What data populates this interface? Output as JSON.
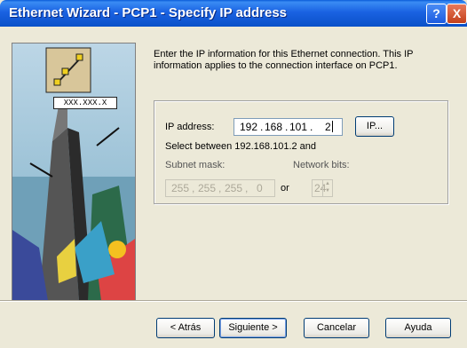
{
  "window": {
    "title": "Ethernet Wizard - PCP1 - Specify IP address",
    "help_glyph": "?",
    "close_glyph": "X"
  },
  "intro": "Enter the IP information for this Ethernet connection. This IP information applies to the connection interface on PCP1.",
  "art": {
    "placeholder_text": "XXX.XXX.X"
  },
  "ip": {
    "label": "IP address:",
    "octets": [
      "192",
      "168",
      "101",
      "2"
    ],
    "button_label": "IP...",
    "range_hint": "Select between 192.168.101.2 and"
  },
  "subnet": {
    "label": "Subnet mask:",
    "octets": [
      "255",
      "255",
      "255",
      "0"
    ],
    "or_label": "or",
    "network_bits_label": "Network bits:",
    "network_bits_value": "24"
  },
  "buttons": {
    "back": "< Atrás",
    "next": "Siguiente >",
    "cancel": "Cancelar",
    "help": "Ayuda"
  },
  "colors": {
    "titlebar": "#0a50c8",
    "dialog_bg": "#ece9d8",
    "accent": "#1c5be0"
  }
}
